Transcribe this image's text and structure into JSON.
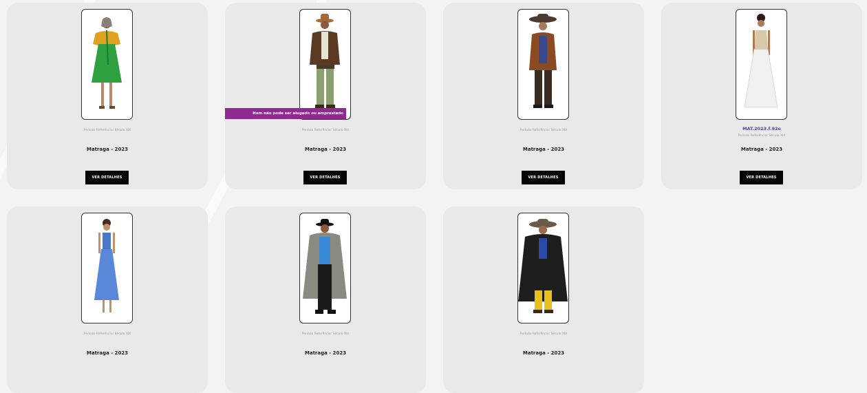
{
  "products": [
    {
      "period": "Período Referência: Século XIX",
      "title": "Matraga - 2023",
      "button": "VER DETALHES"
    },
    {
      "period": "Período Referência: Século XIX",
      "title": "Matraga - 2023",
      "button": "VER DETALHES",
      "badge": "Item não pode ser alugado ou emprestado"
    },
    {
      "period": "Período Referência: Século XIX",
      "title": "Matraga - 2023",
      "button": "VER DETALHES"
    },
    {
      "period": "Período Referência: Século XIX",
      "title": "Matraga - 2023",
      "button": "VER DETALHES",
      "code": "MAT.2023.f.92e"
    },
    {
      "period": "Período Referência: Século XIX",
      "title": "Matraga - 2023"
    },
    {
      "period": "Período Referência: Século XIX",
      "title": "Matraga - 2023"
    },
    {
      "period": "Período Referência: Século XIX",
      "title": "Matraga - 2023"
    }
  ],
  "colors": {
    "badge": "#8f2a8f",
    "button": "#050505",
    "code": "#4a4f9c",
    "card": "#e9e9e9"
  }
}
